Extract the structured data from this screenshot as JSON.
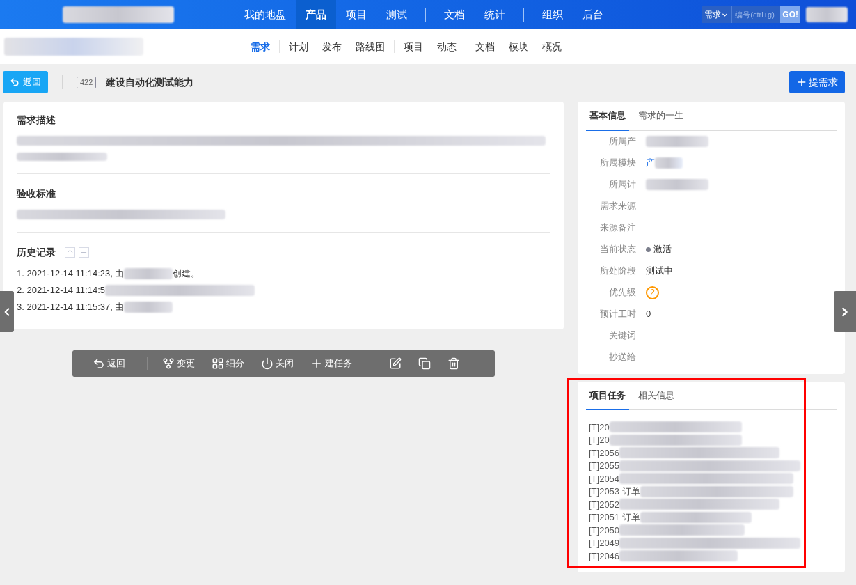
{
  "top_nav": {
    "groups": [
      [
        {
          "label": "我的地盘",
          "selected": false
        },
        {
          "label": "产品",
          "selected": true
        },
        {
          "label": "项目",
          "selected": false
        },
        {
          "label": "测试",
          "selected": false
        }
      ],
      [
        {
          "label": "文档",
          "selected": false
        },
        {
          "label": "统计",
          "selected": false
        }
      ],
      [
        {
          "label": "组织",
          "selected": false
        },
        {
          "label": "后台",
          "selected": false
        }
      ]
    ],
    "search": {
      "scope": "需求",
      "placeholder": "编号(ctrl+g)",
      "button": "GO!"
    }
  },
  "sub_nav": {
    "groups": [
      [
        {
          "label": "需求",
          "selected": true
        }
      ],
      [
        {
          "label": "计划",
          "selected": false
        },
        {
          "label": "发布",
          "selected": false
        },
        {
          "label": "路线图",
          "selected": false
        }
      ],
      [
        {
          "label": "项目",
          "selected": false
        },
        {
          "label": "动态",
          "selected": false
        }
      ],
      [
        {
          "label": "文档",
          "selected": false
        },
        {
          "label": "模块",
          "selected": false
        },
        {
          "label": "概况",
          "selected": false
        }
      ]
    ]
  },
  "header": {
    "back": "返回",
    "id": "422",
    "title": "建设自动化测试能力",
    "create": "提需求"
  },
  "description": {
    "title": "需求描述"
  },
  "acceptance": {
    "title": "验收标准"
  },
  "history": {
    "title": "历史记录",
    "entries": [
      {
        "text": "1. 2021-12-14 11:14:23, 由",
        "tail": "创建。"
      },
      {
        "text": "2. 2021-12-14 11:14:5"
      },
      {
        "text": "3. 2021-12-14 11:15:37, 由"
      }
    ]
  },
  "toolbar": [
    {
      "kind": "back",
      "label": "返回"
    },
    {
      "kind": "change",
      "label": "变更"
    },
    {
      "kind": "split",
      "label": "细分"
    },
    {
      "kind": "close",
      "label": "关闭"
    },
    {
      "kind": "task",
      "label": "建任务"
    },
    {
      "kind": "edit"
    },
    {
      "kind": "copy"
    },
    {
      "kind": "delete"
    }
  ],
  "info_panel": {
    "tabs": [
      {
        "label": "基本信息",
        "selected": true
      },
      {
        "label": "需求的一生",
        "selected": false
      }
    ],
    "fields": [
      {
        "label": "所属产",
        "kind": "blurred"
      },
      {
        "label": "所属模块",
        "kind": "link",
        "value": "产"
      },
      {
        "label": "所属计",
        "kind": "blurred"
      },
      {
        "label": "需求来源",
        "kind": "text"
      },
      {
        "label": "来源备注",
        "kind": "text"
      },
      {
        "label": "当前状态",
        "kind": "status",
        "value": "激活",
        "color": "#7c7f8c"
      },
      {
        "label": "所处阶段",
        "kind": "text",
        "value": "测试中"
      },
      {
        "label": "优先级",
        "kind": "priority",
        "value": "2"
      },
      {
        "label": "预计工时",
        "kind": "text",
        "value": "0"
      },
      {
        "label": "关键词",
        "kind": "text"
      },
      {
        "label": "抄送给",
        "kind": "text"
      }
    ]
  },
  "task_panel": {
    "tabs": [
      {
        "label": "项目任务",
        "selected": true
      },
      {
        "label": "相关信息",
        "selected": false
      }
    ],
    "tasks": [
      "[T]20",
      "[T]20",
      "[T]2056",
      "[T]2055",
      "[T]2054",
      "[T]2053 订单",
      "[T]2052",
      "[T]2051 订单",
      "[T]2050",
      "[T]2049",
      "[T]2046"
    ]
  }
}
